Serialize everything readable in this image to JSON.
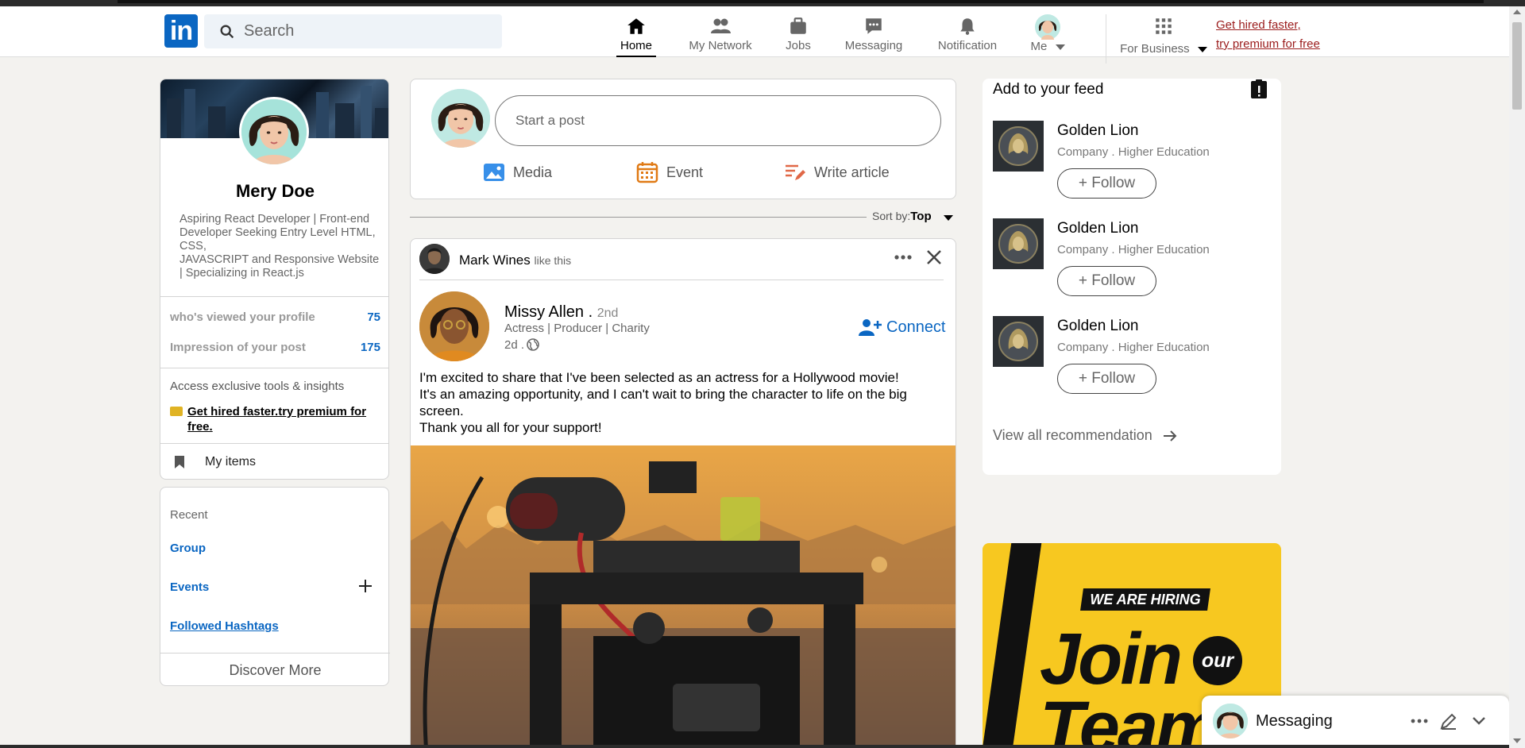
{
  "header": {
    "logo_text": "in",
    "search_placeholder": "Search",
    "nav": [
      {
        "label": "Home",
        "icon": "home-icon",
        "active": true
      },
      {
        "label": "My Network",
        "icon": "network-icon"
      },
      {
        "label": "Jobs",
        "icon": "briefcase-icon"
      },
      {
        "label": "Messaging",
        "icon": "messaging-icon"
      },
      {
        "label": "Notification",
        "icon": "bell-icon"
      },
      {
        "label": "Me",
        "icon": "avatar"
      },
      {
        "label": "For Business",
        "icon": "grid-icon"
      }
    ],
    "premium_line1": "Get hired faster,",
    "premium_line2": "try premium for free"
  },
  "profile": {
    "name": "Mery Doe",
    "headline_lines": [
      "Aspiring React Developer | Front-end",
      "Developer Seeking Entry Level HTML,",
      "CSS,",
      "JAVASCRIPT and Responsive Website",
      "| Specializing in React.js"
    ],
    "stats": [
      {
        "label": "who's viewed your profile",
        "value": "75"
      },
      {
        "label": "Impression of your post",
        "value": "175"
      }
    ],
    "access_text": "Access exclusive tools & insights",
    "premium_promo_line1": "Get hired faster.try premium for",
    "premium_promo_line2": "free.",
    "my_items": "My items"
  },
  "recent": {
    "label": "Recent",
    "group": "Group",
    "events": "Events",
    "hashtags": "Followed Hashtags",
    "discover": "Discover More"
  },
  "share": {
    "placeholder": "Start a post",
    "media": "Media",
    "event": "Event",
    "article": "Write article"
  },
  "sort": {
    "label": "Sort by:",
    "value": "Top"
  },
  "post": {
    "activity_name": "Mark Wines",
    "activity_action": "like this",
    "author_name": "Missy Allen .",
    "author_degree": "2nd",
    "author_subtitle": "Actress | Producer | Charity",
    "author_time": "2d .",
    "connect_label": "Connect",
    "text_lines": [
      "I'm excited to share that I've been selected as an actress for a Hollywood movie!",
      "It's an amazing opportunity, and I can't wait to bring the character to life on the big",
      "screen.",
      "Thank you all for your support!"
    ]
  },
  "feed": {
    "title": "Add to your feed",
    "recommendations": [
      {
        "name": "Golden Lion",
        "subtitle": "Company . Higher Education",
        "button": "+ Follow"
      },
      {
        "name": "Golden Lion",
        "subtitle": "Company . Higher Education",
        "button": "+ Follow"
      },
      {
        "name": "Golden Lion",
        "subtitle": "Company . Higher Education",
        "button": "+ Follow"
      }
    ],
    "view_all": "View all recommendation"
  },
  "ad": {
    "tag": "WE ARE HIRING",
    "line1": "Join",
    "circle": "our",
    "line2": "Team"
  },
  "messaging": {
    "title": "Messaging"
  },
  "colors": {
    "brand_blue": "#0a66c2",
    "premium_red": "#9b1c1c",
    "ad_yellow": "#f7c820",
    "page_bg": "#f3f2ef"
  }
}
